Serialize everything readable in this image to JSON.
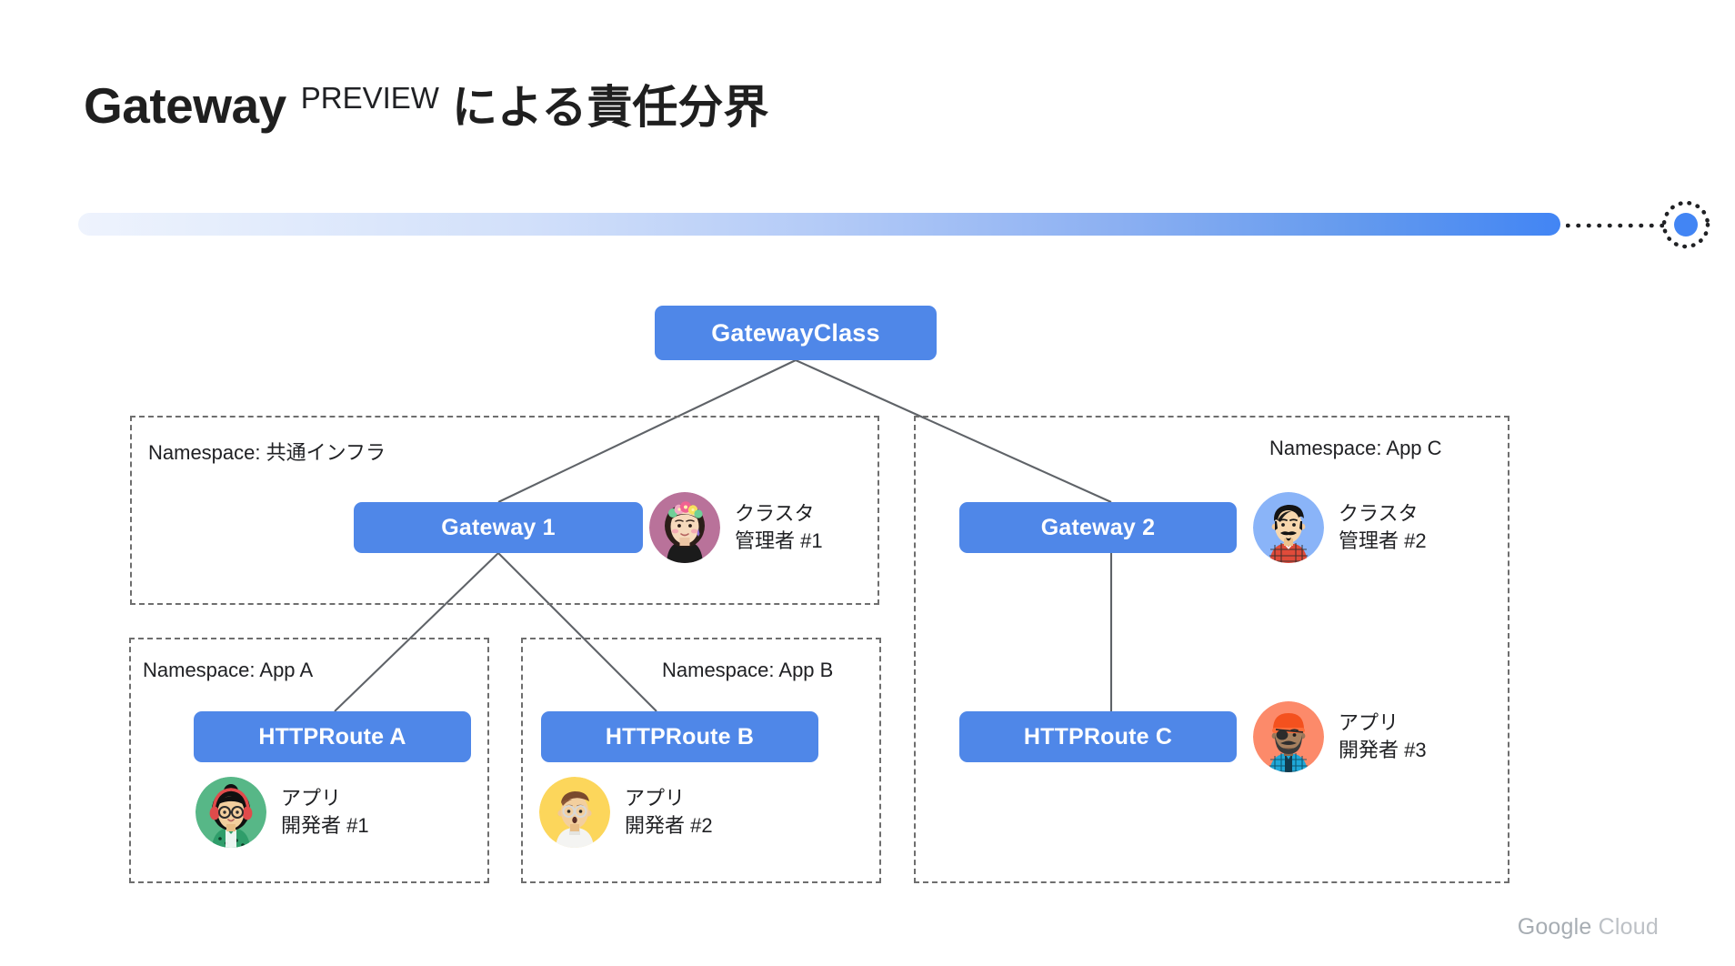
{
  "slide": {
    "title_main": "Gateway",
    "title_preview": "PREVIEW",
    "title_jp": "による責任分界",
    "footer_logo_primary": "Google",
    "footer_logo_secondary": "Cloud"
  },
  "colors": {
    "node_blue": "#4f87e8",
    "accent_blue": "#4285f4",
    "dash_gray": "#6e6e6e",
    "connector_gray": "#5f6368",
    "text_dark": "#202124",
    "logo_gray": "#9aa0a6"
  },
  "diagram": {
    "root": {
      "label": "GatewayClass"
    },
    "namespaces": [
      {
        "id": "shared-infra",
        "label": "Namespace: 共通インフラ",
        "nodes": [
          {
            "label": "Gateway 1"
          }
        ],
        "personas": [
          {
            "role_line1": "クラスタ",
            "role_line2": "管理者 #1",
            "avatar_name": "avatar-cluster-admin-1",
            "avatar_bg": "#b9729a"
          }
        ]
      },
      {
        "id": "app-a",
        "label": "Namespace: App A",
        "nodes": [
          {
            "label": "HTTPRoute A"
          }
        ],
        "personas": [
          {
            "role_line1": "アプリ",
            "role_line2": "開発者 #1",
            "avatar_name": "avatar-app-developer-1",
            "avatar_bg": "#57b787"
          }
        ]
      },
      {
        "id": "app-b",
        "label": "Namespace: App B",
        "nodes": [
          {
            "label": "HTTPRoute B"
          }
        ],
        "personas": [
          {
            "role_line1": "アプリ",
            "role_line2": "開発者 #2",
            "avatar_name": "avatar-app-developer-2",
            "avatar_bg": "#fcd65b"
          }
        ]
      },
      {
        "id": "app-c",
        "label": "Namespace: App C",
        "nodes": [
          {
            "label": "Gateway 2"
          },
          {
            "label": "HTTPRoute C"
          }
        ],
        "personas": [
          {
            "role_line1": "クラスタ",
            "role_line2": "管理者 #2",
            "avatar_name": "avatar-cluster-admin-2",
            "avatar_bg": "#8ab4f8"
          },
          {
            "role_line1": "アプリ",
            "role_line2": "開発者 #3",
            "avatar_name": "avatar-app-developer-3",
            "avatar_bg": "#fc8a6a"
          }
        ]
      }
    ]
  }
}
